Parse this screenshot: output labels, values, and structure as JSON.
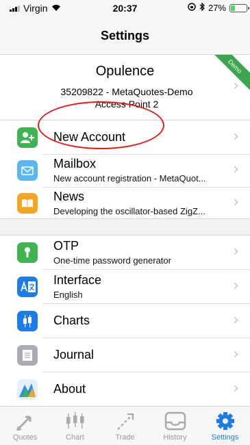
{
  "status_bar": {
    "carrier": "Virgin",
    "time": "20:37",
    "battery_percent": "27%",
    "battery_level": 0.27
  },
  "nav": {
    "title": "Settings"
  },
  "account": {
    "name": "Opulence",
    "server_line1": "35209822 - MetaQuotes-Demo",
    "server_line2": "Access Point 2",
    "badge": "Demo"
  },
  "menu_top": [
    {
      "label": "New Account",
      "icon": "add-user-icon",
      "color": "#3fb551"
    },
    {
      "label": "Mailbox",
      "subtitle": "New account registration - MetaQuot...",
      "icon": "mail-icon",
      "color": "#5ab6f0"
    },
    {
      "label": "News",
      "subtitle": "Developing the oscillator-based ZigZ...",
      "icon": "book-icon",
      "color": "#f4a623"
    }
  ],
  "menu_bottom": [
    {
      "label": "OTP",
      "subtitle": "One-time password generator",
      "icon": "key-icon",
      "color": "#3fb551"
    },
    {
      "label": "Interface",
      "subtitle": "English",
      "icon": "translate-icon",
      "color": "#1c7ce5"
    },
    {
      "label": "Charts",
      "icon": "candlestick-icon",
      "color": "#1c7ce5"
    },
    {
      "label": "Journal",
      "icon": "journal-icon",
      "color": "#a9acb3"
    },
    {
      "label": "About",
      "icon": "metatrader-logo-icon",
      "color": "#2f8fd8"
    }
  ],
  "tabs": [
    {
      "label": "Quotes",
      "icon": "quotes-arrows-icon"
    },
    {
      "label": "Chart",
      "icon": "chart-candles-icon"
    },
    {
      "label": "Trade",
      "icon": "trade-icon"
    },
    {
      "label": "History",
      "icon": "history-tray-icon"
    },
    {
      "label": "Settings",
      "icon": "settings-gear-icon",
      "active": true
    }
  ],
  "colors": {
    "accent": "#1c7ce5",
    "annotation": "#e21a1a",
    "demo_badge": "#3ca54d"
  }
}
